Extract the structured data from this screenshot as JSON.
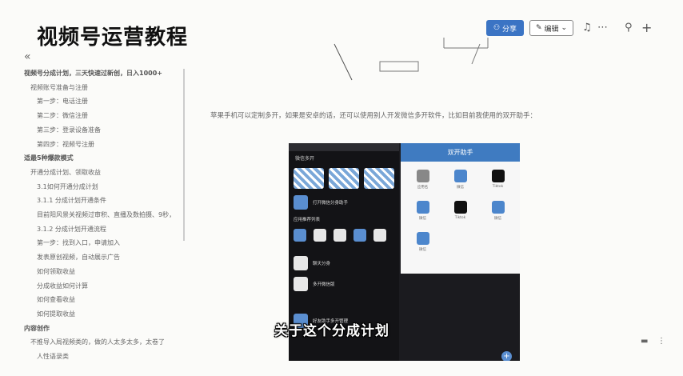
{
  "page": {
    "title": "视频号运营教程"
  },
  "toolbar": {
    "share_label": "分享",
    "edit_label": "编辑",
    "icons": [
      "bell-icon",
      "more-icon",
      "search-icon",
      "plus-icon"
    ]
  },
  "toc": {
    "collapse_glyph": "«",
    "items": [
      {
        "text": "视频号分成计划，三天快速过新创，日入1000+",
        "level": 1
      },
      {
        "text": "视频账号准备与注册",
        "level": 2
      },
      {
        "text": "第一步：电话注册",
        "level": 3
      },
      {
        "text": "第二步：微信注册",
        "level": 3
      },
      {
        "text": "第三步：登录设备准备",
        "level": 3
      },
      {
        "text": "第四步：视频号注册",
        "level": 3
      },
      {
        "text": "适最5种爆款模式",
        "level": 1
      },
      {
        "text": "开通分成计划、领取收益",
        "level": 2
      },
      {
        "text": "3.1如何开通分成计划",
        "level": 3
      },
      {
        "text": "3.1.1 分成计划开通条件",
        "level": 3
      },
      {
        "text": "目前阳风景关视频过审积、直播及数拍摄、9秒，",
        "level": 3
      },
      {
        "text": "3.1.2 分成计划开通流程",
        "level": 3
      },
      {
        "text": "第一步：找到入口，申请加入",
        "level": 3
      },
      {
        "text": "发表原创视频，自动展示广告",
        "level": 3
      },
      {
        "text": "如何领取收益",
        "level": 3
      },
      {
        "text": "分成收益如何计算",
        "level": 3
      },
      {
        "text": "如何查看收益",
        "level": 3
      },
      {
        "text": "如何提取收益",
        "level": 3
      },
      {
        "text": "内容创作",
        "level": 1
      },
      {
        "text": "不推导入局视频类的，做的人太多太多，太卷了",
        "level": 2
      },
      {
        "text": "人性语录类",
        "level": 3
      }
    ]
  },
  "content": {
    "paragraph": "苹果手机可以定制多开，如果是安卓的话，还可以使用别人开发微信多开软件，比如目前我使用的双开助手："
  },
  "phone": {
    "left_title": "微信多开",
    "left_item_1": "打开微信分身助手",
    "left_section": "应用推荐列表",
    "left_item_2": "聊天分身",
    "left_item_3": "多开微信版",
    "left_item_4": "好友助手多开管理",
    "right_title": "双开助手",
    "apps": [
      {
        "name": "应用名",
        "color": "g"
      },
      {
        "name": "微信",
        "color": "b"
      },
      {
        "name": "Tiktok",
        "color": "k"
      },
      {
        "name": "微信",
        "color": "b"
      },
      {
        "name": "Tiktok",
        "color": "k"
      },
      {
        "name": "微信",
        "color": "b"
      },
      {
        "name": "微信",
        "color": "b"
      }
    ]
  },
  "video": {
    "subtitle": "关于这个分成计划"
  }
}
